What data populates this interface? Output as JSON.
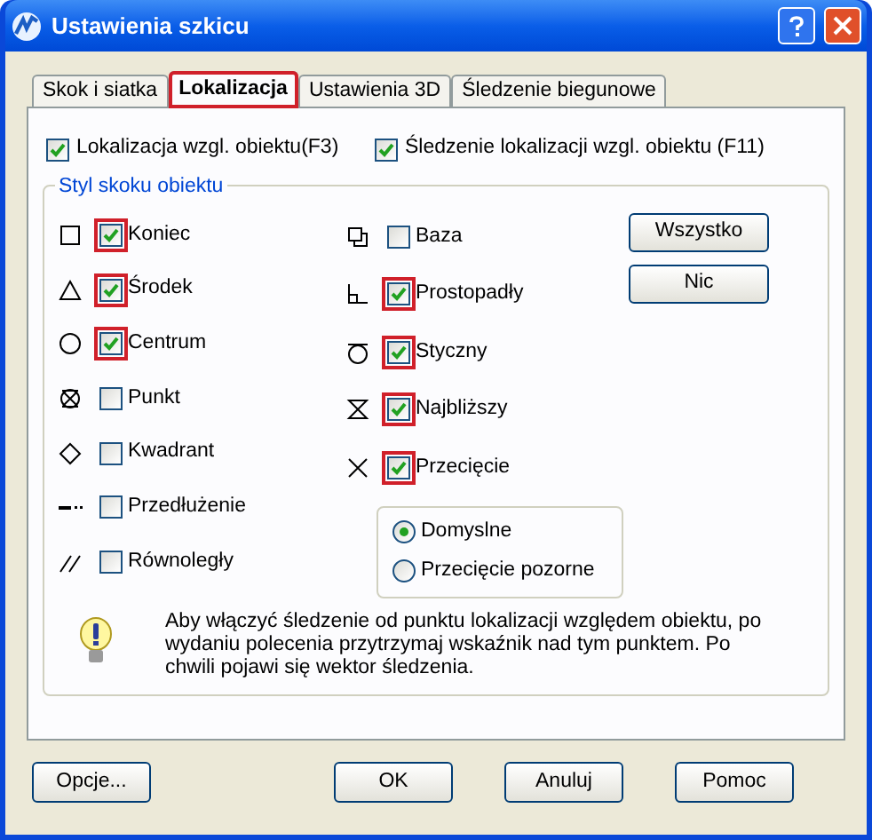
{
  "window": {
    "title": "Ustawienia szkicu"
  },
  "tabs": [
    {
      "label": "Skok i siatka",
      "selected": false,
      "highlighted": false
    },
    {
      "label": "Lokalizacja",
      "selected": true,
      "highlighted": true
    },
    {
      "label": "Ustawienia 3D",
      "selected": false,
      "highlighted": false
    },
    {
      "label": "Śledzenie biegunowe",
      "selected": false,
      "highlighted": false
    }
  ],
  "top_options": [
    {
      "label": "Lokalizacja wzgl. obiektu(F3)",
      "checked": true
    },
    {
      "label": "Śledzenie lokalizacji wzgl. obiektu (F11)",
      "checked": true
    }
  ],
  "group": {
    "title": "Styl skoku obiektu",
    "left_modes": [
      {
        "label": "Koniec",
        "checked": true,
        "highlighted": true
      },
      {
        "label": "Środek",
        "checked": true,
        "highlighted": true
      },
      {
        "label": "Centrum",
        "checked": true,
        "highlighted": true
      },
      {
        "label": "Punkt",
        "checked": false,
        "highlighted": false
      },
      {
        "label": "Kwadrant",
        "checked": false,
        "highlighted": false
      },
      {
        "label": "Przedłużenie",
        "checked": false,
        "highlighted": false
      },
      {
        "label": "Równoległy",
        "checked": false,
        "highlighted": false
      }
    ],
    "right_modes": [
      {
        "label": "Baza",
        "checked": false,
        "highlighted": false
      },
      {
        "label": "Prostopadły",
        "checked": true,
        "highlighted": true
      },
      {
        "label": "Styczny",
        "checked": true,
        "highlighted": true
      },
      {
        "label": "Najbliższy",
        "checked": true,
        "highlighted": true
      },
      {
        "label": "Przecięcie",
        "checked": true,
        "highlighted": true
      }
    ],
    "buttons": [
      "Wszystko",
      "Nic"
    ],
    "intersection_options": [
      {
        "label": "Domyslne",
        "selected": true
      },
      {
        "label": "Przecięcie pozorne",
        "selected": false
      }
    ],
    "hint": "Aby włączyć śledzenie od punktu lokalizacji względem obiektu, po wydaniu polecenia przytrzymaj wskaźnik nad tym punktem. Po chwili pojawi się wektor śledzenia."
  },
  "footer_buttons": [
    {
      "label": "Opcje...",
      "kind": "left"
    },
    {
      "label": "OK",
      "kind": "right"
    },
    {
      "label": "Anuluj",
      "kind": "right"
    },
    {
      "label": "Pomoc",
      "kind": "right"
    }
  ]
}
